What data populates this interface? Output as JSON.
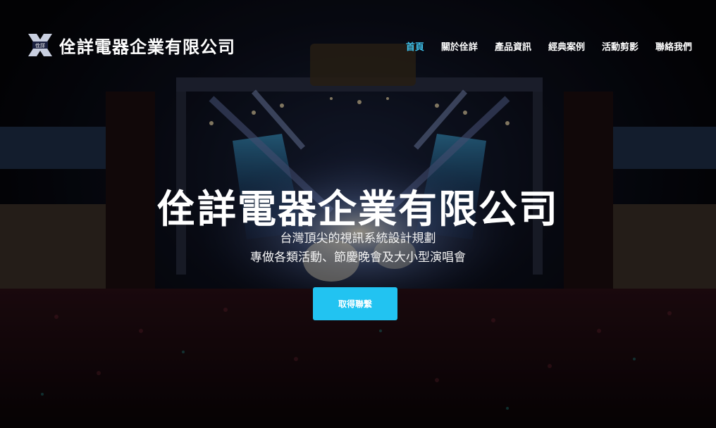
{
  "brand": {
    "logo_text": "佺詳",
    "name": "佺詳電器企業有限公司"
  },
  "nav": {
    "items": [
      {
        "label": "首頁",
        "active": true
      },
      {
        "label": "關於佺詳",
        "active": false
      },
      {
        "label": "產品資訊",
        "active": false
      },
      {
        "label": "經典案例",
        "active": false
      },
      {
        "label": "活動剪影",
        "active": false
      },
      {
        "label": "聯絡我們",
        "active": false
      }
    ]
  },
  "hero": {
    "title": "佺詳電器企業有限公司",
    "subtitle_line1": "台灣頂尖的視訊系統設計規劃",
    "subtitle_line2": "專做各類活動、節慶晚會及大小型演唱會",
    "cta_label": "取得聯繫"
  },
  "colors": {
    "accent": "#22c3f1",
    "nav_active": "#3ec1ea",
    "text": "#ffffff",
    "overlay": "rgba(0,0,0,0.38)"
  }
}
